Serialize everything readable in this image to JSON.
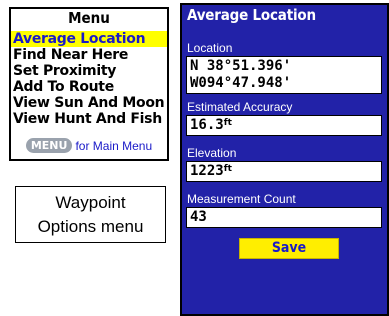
{
  "waypoint_menu": {
    "title": "Menu",
    "items": [
      {
        "label": "Average Location",
        "selected": true
      },
      {
        "label": "Find Near Here",
        "selected": false
      },
      {
        "label": "Set Proximity",
        "selected": false
      },
      {
        "label": "Add To Route",
        "selected": false
      },
      {
        "label": "View Sun And Moon",
        "selected": false
      },
      {
        "label": "View Hunt And Fish",
        "selected": false
      }
    ],
    "footer_key": "MENU",
    "footer_text": "for Main Menu"
  },
  "caption": {
    "line1": "Waypoint",
    "line2": "Options menu"
  },
  "average_location": {
    "title": "Average Location",
    "location_label": "Location",
    "latitude": "N  38°51.396'",
    "longitude": "W094°47.948'",
    "accuracy_label": "Estimated Accuracy",
    "accuracy_value": "16.3",
    "accuracy_unit": "ft",
    "elevation_label": "Elevation",
    "elevation_value": "1223",
    "elevation_unit": "ft",
    "count_label": "Measurement Count",
    "count_value": "43",
    "save_label": "Save"
  },
  "colors": {
    "page_blue": "#2222a8",
    "highlight_yellow": "#ffff00",
    "button_yellow": "#ffee00",
    "text_blue": "#1a1ac8"
  }
}
